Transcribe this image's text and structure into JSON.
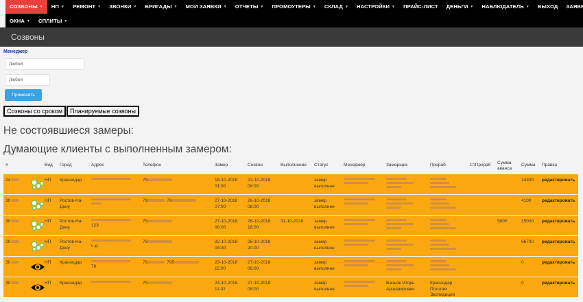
{
  "nav": {
    "row1": [
      {
        "label": "СОЗВОНЫ",
        "active": true,
        "caret": true
      },
      {
        "label": "НП",
        "caret": true
      },
      {
        "label": "РЕМОНТ",
        "caret": true
      },
      {
        "label": "ЗВОНКИ",
        "caret": true
      },
      {
        "label": "БРИГАДЫ",
        "caret": true
      },
      {
        "label": "МОИ ЗАЯВКИ",
        "caret": true
      },
      {
        "label": "ОТЧЕТЫ",
        "caret": true
      },
      {
        "label": "ПРОМОУТЕРЫ",
        "caret": true
      },
      {
        "label": "СКЛАД",
        "caret": true
      },
      {
        "label": "НАСТРОЙКИ",
        "caret": true
      },
      {
        "label": "ПРАЙС-ЛИСТ",
        "caret": false
      },
      {
        "label": "ДЕНЬГИ",
        "caret": true
      },
      {
        "label": "НАБЛЮДАТЕЛЬ",
        "caret": true
      },
      {
        "label": "ВЫХОД",
        "caret": false
      },
      {
        "label": "ЗАЯВКИ МЕБ",
        "caret": false
      }
    ],
    "row2": [
      {
        "label": "ОКНА",
        "caret": true
      },
      {
        "label": "СПЛИТЫ",
        "caret": true
      }
    ]
  },
  "page_title": "Созвоны",
  "filters": {
    "manager_label": "Менеджер",
    "select1_value": "Любой",
    "select2_value": "Любой",
    "apply_label": "Применить"
  },
  "tabs": [
    "Созвоны со сроком",
    "Планируемые созвоны"
  ],
  "sections": {
    "s1": "Не состоявшиеся замеры:",
    "s2": "Думающие клиенты с выполненным замером:"
  },
  "table": {
    "headers": [
      "#",
      "Вид",
      "Город",
      "Адрес",
      "Телефон",
      "Замер",
      "Созвон",
      "Выполнение",
      "Статус",
      "Менеджер",
      "Замерщик",
      "Прораб",
      "СтПрораб",
      "Сумма аванса",
      "Сумма",
      "Правка"
    ],
    "rows": [
      {
        "id": "24",
        "icon": "green-dots",
        "vid": "НП",
        "city": [
          "Краснодар"
        ],
        "addr": [],
        "phone": "79",
        "zamer": [
          "18-10-2018",
          "01:00"
        ],
        "sozvon": [
          "22-10-2018",
          "08:00"
        ],
        "vyp": "",
        "status": [
          "замер",
          "выполнен"
        ],
        "zamershik": [],
        "prorab": [],
        "avans": "",
        "summa": "14300",
        "edit": "редактировать"
      },
      {
        "id": "30",
        "icon": "green-dots",
        "vid": "НП",
        "city": [
          "Ростов-На-",
          "Дону"
        ],
        "addr": [],
        "phone": "79 79",
        "zamer": [
          "27-10-2018",
          "07:00"
        ],
        "sozvon": [
          "26-10-2018",
          "08:00"
        ],
        "vyp": "",
        "status": [
          "замер",
          "выполнен"
        ],
        "zamershik": [],
        "prorab": [],
        "avans": "",
        "summa": "4100",
        "edit": "редактировать"
      },
      {
        "id": "30",
        "icon": "green-dots",
        "vid": "НП",
        "city": [
          "Ростов-На-",
          "Дону"
        ],
        "addr": [
          "123"
        ],
        "phone": "79",
        "zamer": [
          "27-10-2018",
          "08:00"
        ],
        "sozvon": [
          "26-10-2018",
          "18:00"
        ],
        "vyp": "31-10-2018",
        "status": [
          "замер",
          "выполнен"
        ],
        "zamershik": [],
        "prorab": [],
        "avans": "5000",
        "summa": "15000",
        "edit": "редактировать"
      },
      {
        "id": "29",
        "icon": "green-dots",
        "vid": "НП",
        "city": [
          "Ростов-На-",
          "Дону"
        ],
        "addr": [
          "ч.д."
        ],
        "phone": "79",
        "zamer": [
          "22-10-2018",
          "04:30"
        ],
        "sozvon": [
          "26-10-2018",
          "20:00"
        ],
        "vyp": "",
        "status": [
          "замер",
          "выполнен"
        ],
        "zamershik": [],
        "prorab": [],
        "avans": "",
        "summa": "96700",
        "edit": "редактировать"
      },
      {
        "id": "30",
        "icon": "eye",
        "vid": "НП",
        "city": [
          "Краснодар"
        ],
        "addr": [
          "70"
        ],
        "phone": "78 795",
        "zamer": [
          "23-10-2018",
          "15:00"
        ],
        "sozvon": [
          "27-10-2018",
          "08:00"
        ],
        "vyp": "",
        "status": [
          "замер",
          "выполнен"
        ],
        "zamershik": [],
        "prorab": [],
        "avans": "",
        "summa": "0",
        "edit": "редактировать"
      },
      {
        "id": "30",
        "icon": "eye",
        "vid": "НП",
        "city": [
          "Краснодар"
        ],
        "addr": [],
        "phone": "79",
        "zamer": [
          "24-10-2018",
          "11:02"
        ],
        "sozvon": [
          "27-10-2018",
          "08:00"
        ],
        "vyp": "",
        "status": [
          "замер",
          "выполнен"
        ],
        "zamershik": [
          "Ваньян Игорь",
          "Аршавирович"
        ],
        "prorab": [
          "Краснодар",
          "Потолки",
          "Экспедиция"
        ],
        "avans": "",
        "summa": "0",
        "edit": "редактировать"
      }
    ]
  },
  "colors": {
    "active_nav": "#e8413c",
    "row_bg": "#fba810",
    "apply_btn": "#3ba3e0",
    "icon_green": "#7fc242"
  }
}
